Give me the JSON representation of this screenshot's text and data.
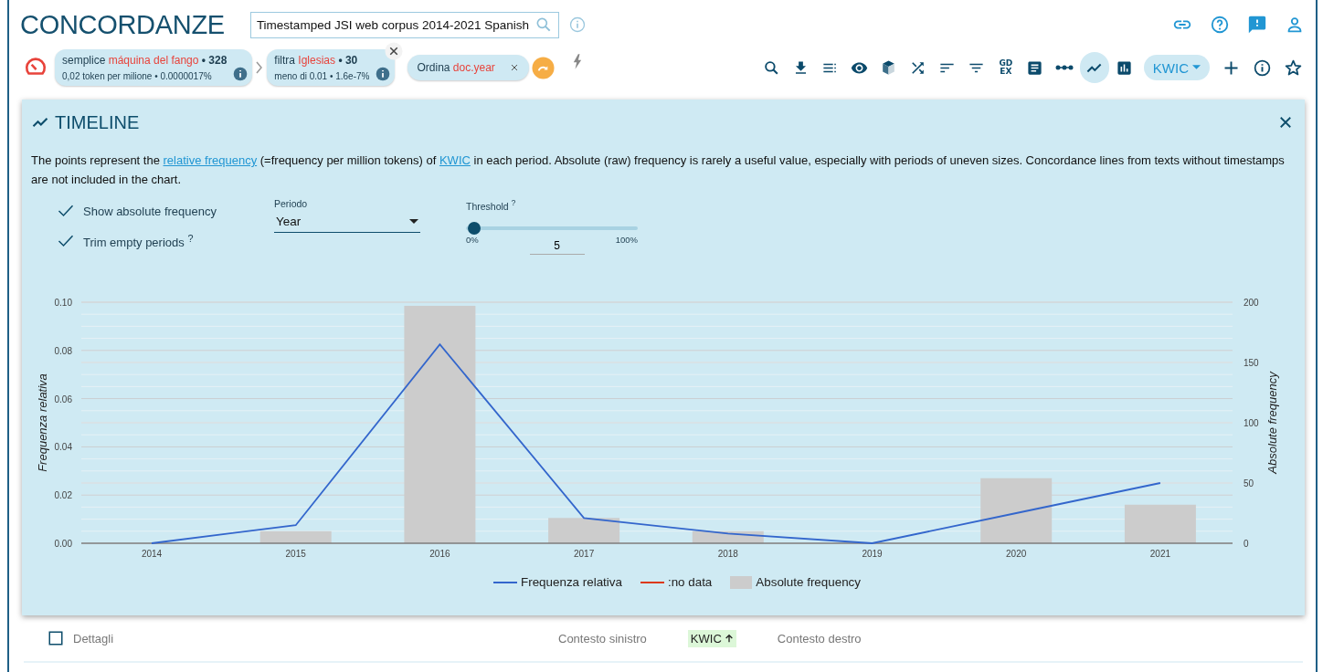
{
  "header": {
    "title": "CONCORDANZE",
    "corpus": "Timestamped JSI web corpus 2014-2021 Spanish"
  },
  "query_chips": [
    {
      "kind": "query",
      "prefix": "semplice",
      "term": "máquina del fango",
      "count": "• 328",
      "detail": "0,02 token per milione • 0.0000017%"
    },
    {
      "kind": "query",
      "prefix": "filtra",
      "term": "Iglesias",
      "count": "• 30",
      "detail": "meno di 0.01 • 1.6e-7%",
      "closable": true
    },
    {
      "kind": "sort",
      "prefix": "Ordina",
      "term": "doc.year"
    }
  ],
  "toolbar": [
    {
      "selected": false
    },
    {
      "selected": false
    },
    {
      "selected": false
    },
    {
      "selected": false
    },
    {
      "selected": false
    },
    {
      "selected": false
    },
    {
      "selected": false
    },
    {
      "selected": false
    },
    {
      "selected": false,
      "text": [
        "GD",
        "EX"
      ]
    },
    {
      "selected": false
    },
    {
      "selected": false
    },
    {
      "selected": true
    },
    {
      "selected": false
    }
  ],
  "view_select": {
    "label": "KWIC"
  },
  "timeline": {
    "title": "TIMELINE",
    "description": [
      {
        "text": "The points represent the "
      },
      {
        "link": "relative frequency"
      },
      {
        "text": " (=frequency per million tokens) of "
      },
      {
        "link": "KWIC"
      },
      {
        "text": " in each period. Absolute (raw) frequency is rarely a useful value, especially with periods of uneven sizes. Concordance lines from texts without timestamps are not included in the chart."
      }
    ],
    "options": [
      {
        "label": "Show absolute frequency",
        "checked": true
      },
      {
        "label": "Trim empty periods $^{?}$",
        "checked": true
      }
    ],
    "period": {
      "label": "Periodo",
      "value": "Year"
    },
    "threshold": {
      "label": "Threshold $^{?}$",
      "level": 0.05,
      "min_label": "0%",
      "max_label": "100%",
      "value": "5"
    },
    "chart_data": {
      "type": "bar",
      "grid": true,
      "legend": "bottom",
      "ylabel": "Frequenza relativa",
      "y2label": "Absolute frequency",
      "categories": [
        "2014",
        "2015",
        "2016",
        "2017",
        "2018",
        "2019",
        "2020",
        "2021"
      ],
      "ylim": [
        0,
        0.1
      ],
      "yticks": [
        {
          "value": 0,
          "label": "0.00"
        },
        {
          "value": 0.02,
          "label": "0.02"
        },
        {
          "value": 0.04,
          "label": "0.04"
        },
        {
          "value": 0.06,
          "label": "0.06"
        },
        {
          "value": 0.08,
          "label": "0.08"
        },
        {
          "value": 0.1,
          "label": "0.10"
        }
      ],
      "y2lim": [
        0,
        200
      ],
      "y2ticks": [
        0,
        50,
        100,
        150,
        200
      ],
      "series": [
        {
          "name": "Frequenza relativa",
          "color": "#3366cc",
          "type": "line",
          "values": [
            0,
            0.0075,
            0.0825,
            0.0105,
            0.004,
            0,
            0.0125,
            0.025
          ]
        },
        {
          "name": ":no data",
          "color": "#dc3912",
          "type": "line",
          "values": [
            null,
            null,
            null,
            null,
            null,
            null,
            null,
            null
          ]
        },
        {
          "name": "Absolute frequency",
          "color": "#cccccc",
          "axis": "y2",
          "values": [
            0,
            10,
            197,
            21,
            10,
            0,
            54,
            32
          ]
        }
      ]
    }
  },
  "results_header": {
    "details": {
      "label": "Dettagli",
      "checked": false
    },
    "columns": [
      {
        "label": "Contesto sinistro",
        "sorted": false
      },
      {
        "label": "KWIC",
        "sorted": true
      },
      {
        "label": "Contesto destro",
        "sorted": false
      }
    ]
  }
}
